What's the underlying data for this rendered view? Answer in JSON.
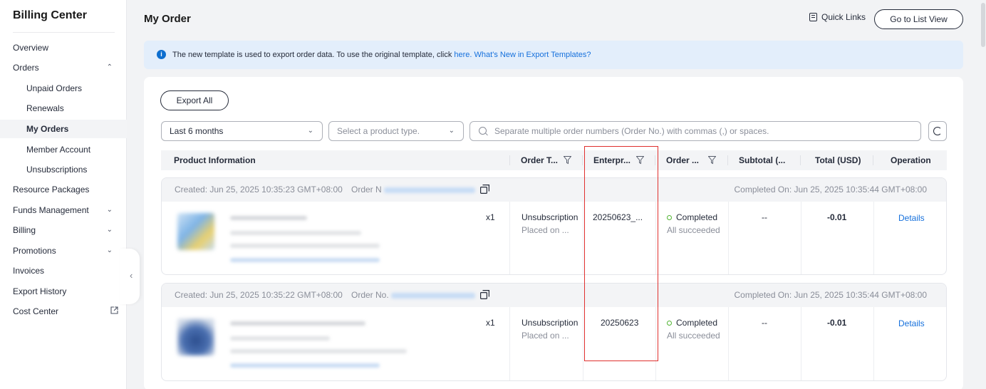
{
  "sidebar": {
    "title": "Billing Center",
    "items": [
      {
        "label": "Overview"
      },
      {
        "label": "Orders",
        "chevron": "^"
      },
      {
        "label": "Unpaid Orders"
      },
      {
        "label": "Renewals"
      },
      {
        "label": "My Orders"
      },
      {
        "label": "Member Account"
      },
      {
        "label": "Unsubscriptions"
      },
      {
        "label": "Resource Packages"
      },
      {
        "label": "Funds Management",
        "chevron": "v"
      },
      {
        "label": "Billing",
        "chevron": "v"
      },
      {
        "label": "Promotions",
        "chevron": "v"
      },
      {
        "label": "Invoices"
      },
      {
        "label": "Export History"
      },
      {
        "label": "Cost Center"
      }
    ]
  },
  "header": {
    "title": "My Order",
    "quick_links": "Quick Links",
    "go_to_list_view": "Go to List View"
  },
  "notice": {
    "info_icon": "i",
    "text": "The new template is used to export order data. To use the original template, click ",
    "link_here": "here.",
    "link_whats_new": "What's New in Export Templates?"
  },
  "toolbar": {
    "export_all": "Export All",
    "period": "Last 6 months",
    "product_placeholder": "Select a product type.",
    "search_placeholder": "Separate multiple order numbers (Order No.) with commas (,) or spaces."
  },
  "table": {
    "columns": [
      "Product Information",
      "Order T...",
      "Enterpr...",
      "Order ...",
      "Subtotal (...",
      "Total (USD)",
      "Operation"
    ]
  },
  "orders": [
    {
      "created": "Created: Jun 25, 2025 10:35:23 GMT+08:00",
      "order_no_label": "Order N",
      "completed_on": "Completed On: Jun 25, 2025 10:35:44 GMT+08:00",
      "quantity": "x1",
      "order_type": "Unsubscription",
      "placed_on": "Placed on ...",
      "enterprise": "20250623_...",
      "status": "Completed",
      "status_detail": "All succeeded",
      "subtotal": "--",
      "total": "-0.01",
      "operation": "Details"
    },
    {
      "created": "Created: Jun 25, 2025 10:35:22 GMT+08:00",
      "order_no_label": "Order No.",
      "completed_on": "Completed On: Jun 25, 2025 10:35:44 GMT+08:00",
      "quantity": "x1",
      "order_type": "Unsubscription",
      "placed_on": "Placed on ...",
      "enterprise": "20250623",
      "status": "Completed",
      "status_detail": "All succeeded",
      "subtotal": "--",
      "total": "-0.01",
      "operation": "Details"
    }
  ],
  "colors": {
    "accent": "#1570dc",
    "success": "#50b431",
    "highlight": "#e0302e",
    "notice_bg": "#e3eefb"
  }
}
